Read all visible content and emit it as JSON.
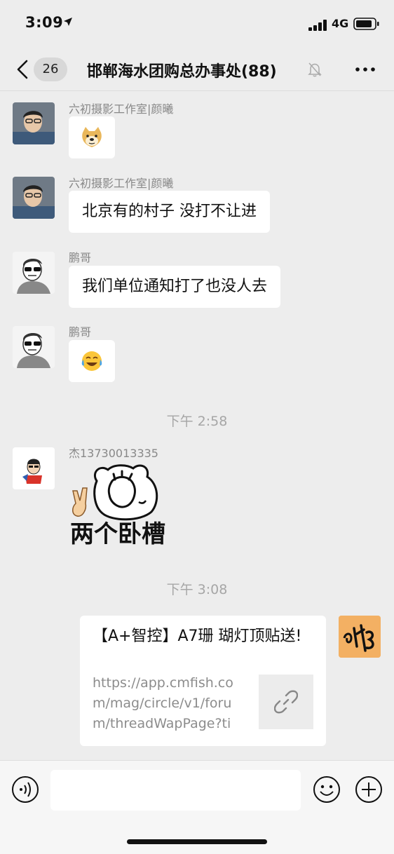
{
  "status_bar": {
    "time": "3:09",
    "network": "4G",
    "icons": [
      "location-arrow-icon",
      "signal-icon",
      "battery-icon"
    ]
  },
  "header": {
    "unread_count": "26",
    "title": "邯郸海水团购总办事处(88)",
    "icons": [
      "back-chevron-icon",
      "mute-bell-icon",
      "more-dots-icon"
    ]
  },
  "messages": [
    {
      "sender": "六初摄影工作室|颜曦",
      "type": "sticker",
      "content": "",
      "sticker": "doge-emoji"
    },
    {
      "sender": "六初摄影工作室|颜曦",
      "type": "text",
      "content": "北京有的村子 没打不让进"
    },
    {
      "sender": "鹏哥",
      "type": "text",
      "content": "我们单位通知打了也没人去"
    },
    {
      "sender": "鹏哥",
      "type": "sticker",
      "content": "",
      "sticker": "crying-laughing-emoji"
    },
    {
      "type": "time",
      "content": "下午 2:58"
    },
    {
      "sender": "杰13730013335",
      "type": "sticker",
      "content": "两个卧槽",
      "sticker": "bear-facepalm-sticker"
    },
    {
      "type": "time",
      "content": "下午 3:08"
    },
    {
      "sender": "self",
      "type": "link",
      "title": "【A+智控】A7珊 瑚灯顶贴送!",
      "url": "https://app.cmfish.com/mag/circle/v1/forum/threadWapPage?tid...",
      "thumb_icon": "link-icon"
    }
  ],
  "input_bar": {
    "placeholder": "",
    "icons": [
      "voice-icon",
      "emoji-icon",
      "plus-icon"
    ]
  },
  "colors": {
    "background": "#ededed",
    "bubble": "#ffffff",
    "input_bar": "#f6f6f6"
  }
}
